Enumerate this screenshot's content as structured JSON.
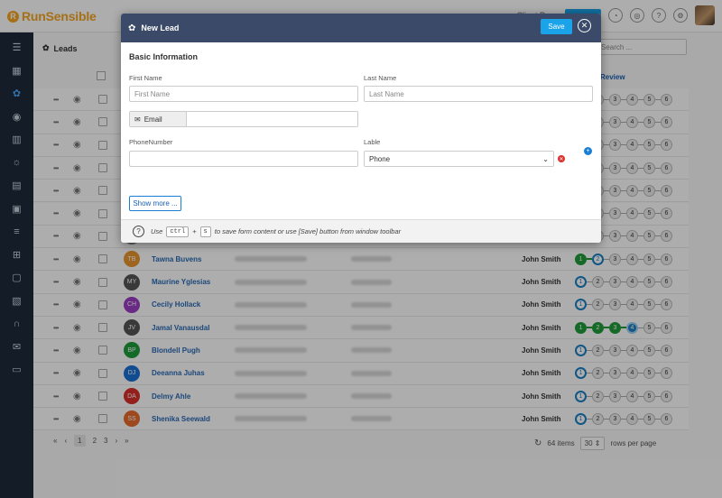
{
  "app": {
    "logo_text": "RunSensible",
    "logo_glyph": "R"
  },
  "topbar": {
    "link": "Client Po…",
    "icons": [
      "bell-icon",
      "headset-icon",
      "help-icon",
      "gear-icon"
    ]
  },
  "sidebar": {
    "icons": [
      "menu-icon",
      "dashboard-icon",
      "leads-icon",
      "contacts-icon",
      "companies-icon",
      "ideas-icon",
      "documents-icon",
      "bookmark-icon",
      "workflow-icon",
      "org-chart-icon",
      "calendar-icon",
      "library-icon",
      "support-icon",
      "mail-icon",
      "folder-icon"
    ]
  },
  "main": {
    "title": "Leads",
    "search_placeholder": "Search ...",
    "review_header": "Review"
  },
  "rows": [
    {
      "initials": "",
      "name": "",
      "owner": "",
      "color": "#888888",
      "steps": []
    },
    {
      "initials": "",
      "name": "",
      "owner": "",
      "color": "#888888",
      "steps": []
    },
    {
      "initials": "",
      "name": "",
      "owner": "",
      "color": "#888888",
      "steps": []
    },
    {
      "initials": "",
      "name": "",
      "owner": "",
      "color": "#888888",
      "steps": []
    },
    {
      "initials": "",
      "name": "",
      "owner": "",
      "color": "#888888",
      "steps": []
    },
    {
      "initials": "",
      "name": "",
      "owner": "",
      "color": "#888888",
      "steps": []
    },
    {
      "initials": "",
      "name": "",
      "owner": "",
      "color": "#888888",
      "steps": []
    },
    {
      "initials": "TB",
      "name": "Tawna Buvens",
      "owner": "John Smith",
      "color": "#e8952b",
      "steps": [
        "done",
        "cur",
        "n",
        "n",
        "n",
        "n"
      ]
    },
    {
      "initials": "MY",
      "name": "Maurine Yglesias",
      "owner": "John Smith",
      "color": "#555555",
      "steps": [
        "cur",
        "n",
        "n",
        "n",
        "n",
        "n"
      ]
    },
    {
      "initials": "CH",
      "name": "Cecily Hollack",
      "owner": "John Smith",
      "color": "#9b3fc4",
      "steps": [
        "cur",
        "n",
        "n",
        "n",
        "n",
        "n"
      ]
    },
    {
      "initials": "JV",
      "name": "Jamal Vanausdal",
      "owner": "John Smith",
      "color": "#555555",
      "steps": [
        "done",
        "done",
        "done",
        "curdone",
        "n",
        "n"
      ]
    },
    {
      "initials": "BP",
      "name": "Blondell Pugh",
      "owner": "John Smith",
      "color": "#1f9d3a",
      "steps": [
        "cur",
        "n",
        "n",
        "n",
        "n",
        "n"
      ]
    },
    {
      "initials": "DJ",
      "name": "Deeanna Juhas",
      "owner": "John Smith",
      "color": "#1a6fd4",
      "steps": [
        "cur",
        "n",
        "n",
        "n",
        "n",
        "n"
      ]
    },
    {
      "initials": "DA",
      "name": "Delmy Ahle",
      "owner": "John Smith",
      "color": "#d9302c",
      "steps": [
        "cur",
        "n",
        "n",
        "n",
        "n",
        "n"
      ]
    },
    {
      "initials": "SS",
      "name": "Shenika Seewald",
      "owner": "John Smith",
      "color": "#e86a2b",
      "steps": [
        "cur",
        "n",
        "n",
        "n",
        "n",
        "n"
      ]
    }
  ],
  "pager": {
    "first": "«",
    "prev": "‹",
    "pages": [
      "1",
      "2",
      "3"
    ],
    "next": "›",
    "last": "»",
    "items": "64 items",
    "per_page": "30",
    "per_page_label": "rows per page"
  },
  "modal": {
    "title": "New Lead",
    "save_label": "Save",
    "section_title": "Basic Information",
    "first_name_label": "First Name",
    "first_name_placeholder": "First Name",
    "last_name_label": "Last Name",
    "last_name_placeholder": "Last Name",
    "email_label": "Email",
    "email_value": "",
    "phone_label": "PhoneNumber",
    "phone_value": "",
    "lable_label": "Lable",
    "lable_value": "Phone",
    "show_more_label": "Show more ...",
    "footer": {
      "use": "Use",
      "key1": "ctrl",
      "plus": "+",
      "key2": "s",
      "text": "to save form content or use [Save] button from window toolbar"
    }
  }
}
